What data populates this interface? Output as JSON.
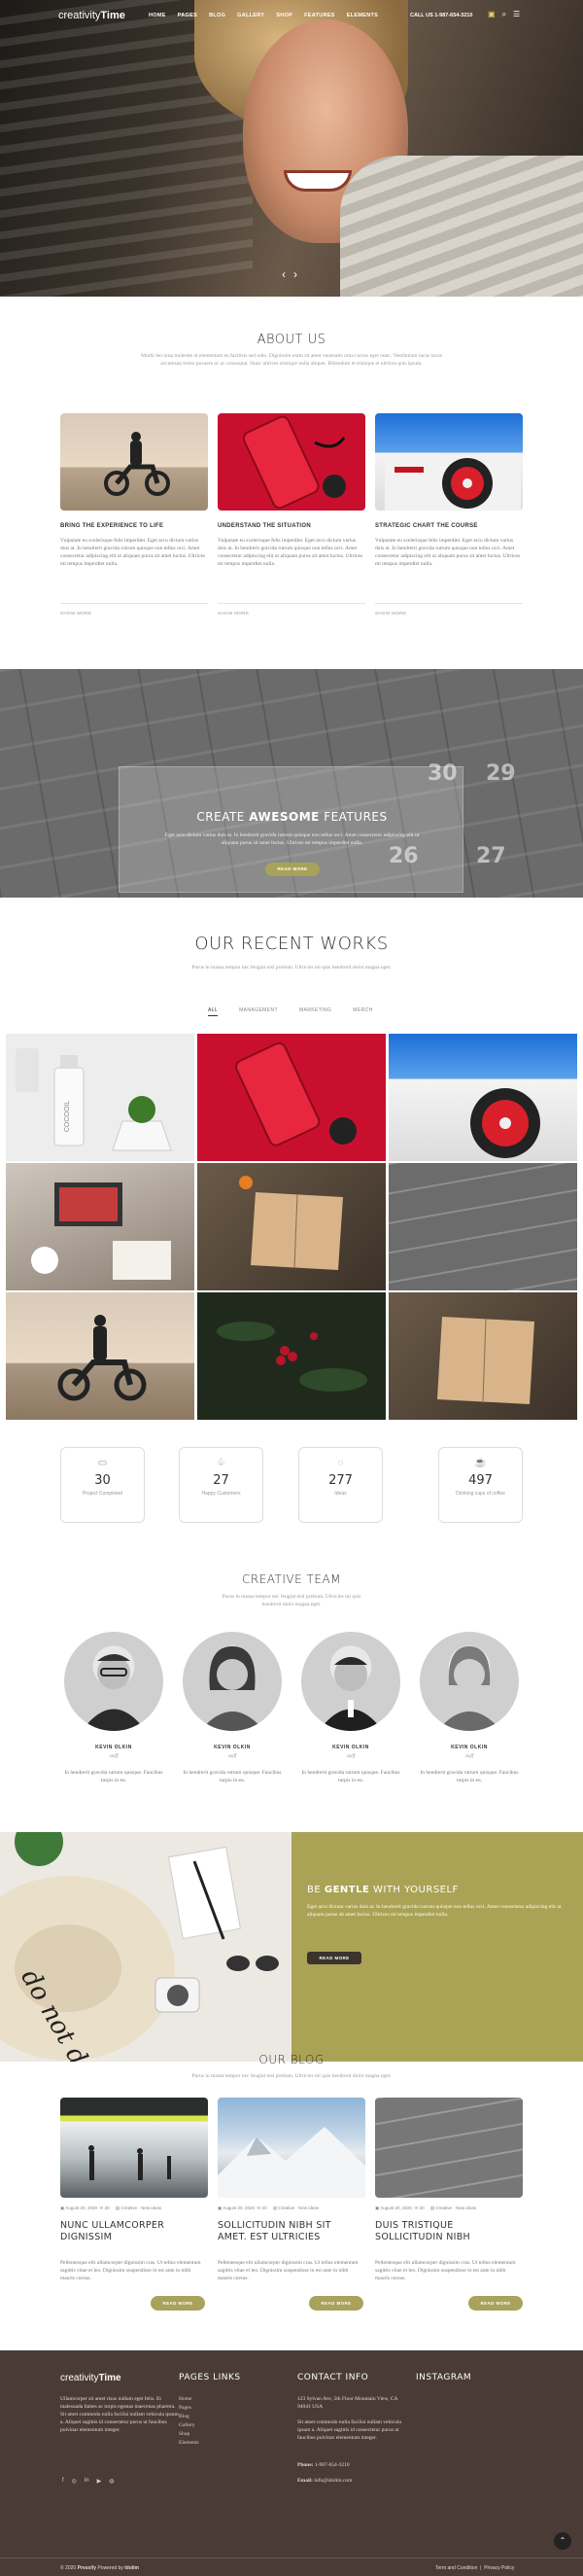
{
  "nav": {
    "logo_light": "creativity",
    "logo_bold": "Time",
    "items": [
      "HOME",
      "PAGES",
      "BLOG",
      "GALLERY",
      "SHOP",
      "FEATURES",
      "ELEMENTS"
    ],
    "call": "CALL US 1-987-654-3210"
  },
  "about": {
    "title": "ABOUT US",
    "subtitle": "Morbi leo urna molestie at elementum eu facilisis sed odio. Dignissim enim sit amet venenatis urna cursus eget nunc. Vestibulum lacus lacus accumsan tortor posuere ac ut consequat. Nunc ultrices tristique nulla aliquet. Bibendum et tristique et ultrices quis ipsum.",
    "cards": [
      {
        "title": "BRING THE EXPERIENCE TO LIFE",
        "text": "Vulputate eu scelerisque felis imperdiet. Eget arcu dictum varius duis at. In hendrerit gravida rutrum quisque non tellus orci. Amet consectetur adipiscing elit ut aliquam purus sit amet luctus. Ultrices mi tempus imperdiet nulla.",
        "more": "SHOW MORE"
      },
      {
        "title": "UNDERSTAND THE SITUATION",
        "text": "Vulputate eu scelerisque felis imperdiet. Eget arcu dictum varius duis at. In hendrerit gravida rutrum quisque non tellus orci. Amet consectetur adipiscing elit ut aliquam purus sit amet luctus. Ultrices mi tempus imperdiet nulla.",
        "more": "SHOW MORE"
      },
      {
        "title": "STRATEGIC CHART THE COURSE",
        "text": "Vulputate eu scelerisque felis imperdiet. Eget arcu dictum varius duis at. In hendrerit gravida rutrum quisque non tellus orci. Amet consectetur adipiscing elit ut aliquam purus sit amet luctus. Ultrices mi tempus imperdiet nulla.",
        "more": "SHOW MORE"
      }
    ]
  },
  "features": {
    "title_pre": "CREATE ",
    "title_bold": "AWESOME",
    "title_post": " FEATURES",
    "text": "Eget arcu dictum varius duis at. In hendrerit gravida rutrum quisque non tellus orci. Amet consectetur adipiscing elit ut aliquam purus sit amet luctus. Ultrices mi tempus imperdiet nulla.",
    "button": "READ MORE",
    "tile_numbers": [
      "30",
      "29",
      "27",
      "26"
    ]
  },
  "works": {
    "title": "OUR RECENT WORKS",
    "subtitle": "Purus in massa tempor nec feugiat nisl pretium. Ultricies mi quis hendrerit dolor magna eget.",
    "filters": [
      "ALL",
      "MANAGEMENT",
      "MARKETING",
      "MERCH"
    ],
    "bottle_label": "COCOOIL"
  },
  "stats": [
    {
      "num": "30",
      "label": "Project Completed",
      "icon": "monitor-icon"
    },
    {
      "num": "27",
      "label": "Happy Customers",
      "icon": "thumbs-up-icon"
    },
    {
      "num": "277",
      "label": "Ideas",
      "icon": "lightbulb-icon"
    },
    {
      "num": "497",
      "label": "Drinking cups of coffee",
      "icon": "coffee-icon"
    }
  ],
  "team": {
    "title": "CREATIVE TEAM",
    "subtitle": "Purus in massa tempor nec feugiat nisl pretium. Ultricies mi quis hendrerit dolor magna eget.",
    "members": [
      {
        "name": "KEVIN OLKIN",
        "role": "staff",
        "desc": "In hendrerit gravida rutrum quisque. Faucibus turpis in eu."
      },
      {
        "name": "KEVIN OLKIN",
        "role": "staff",
        "desc": "In hendrerit gravida rutrum quisque. Faucibus turpis in eu."
      },
      {
        "name": "KEVIN OLKIN",
        "role": "staff",
        "desc": "In hendrerit gravida rutrum quisque. Faucibus turpis in eu."
      },
      {
        "name": "KEVIN OLKIN",
        "role": "staff",
        "desc": "In hendrerit gravida rutrum quisque. Faucibus turpis in eu."
      }
    ]
  },
  "gentle": {
    "title_pre": "BE ",
    "title_bold": "GENTLE",
    "title_post": " WITH YOURSELF",
    "text": "Eget arcu dictum varius duis at. In hendrerit gravida rutrum quisque non tellus orci. Amet consectetur adipiscing elit ut aliquam purus sit amet luctus. Ultrices mi tempus imperdiet nulla.",
    "button": "READ MORE",
    "hat_text": "do not disturb"
  },
  "blog": {
    "title": "OUR BLOG",
    "subtitle": "Purus in massa tempor nec feugiat nisl pretium. Ultricies mi quis hendrerit dolor magna eget.",
    "posts": [
      {
        "date": "August 20, 2020",
        "comments": "20",
        "cats": "Creative · New ideas",
        "title": "NUNC ULLAMCORPER DIGNISSIM",
        "desc": "Pellentesque elit ullamcorper dignissim cras. Ut tellus elementum sagittis vitae et leo. Dignissim suspendisse in est ante in nibh mauris cursus.",
        "button": "READ MORE"
      },
      {
        "date": "August 20, 2020",
        "comments": "20",
        "cats": "Creative · New ideas",
        "title": "SOLLICITUDIN NIBH SIT AMET. EST ULTRICIES",
        "desc": "Pellentesque elit ullamcorper dignissim cras. Ut tellus elementum sagittis vitae et leo. Dignissim suspendisse in est ante in nibh mauris cursus.",
        "button": "READ MORE"
      },
      {
        "date": "August 20, 2020",
        "comments": "20",
        "cats": "Creative · New ideas",
        "title": "DUIS TRISTIQUE SOLLICITUDIN NIBH",
        "desc": "Pellentesque elit ullamcorper dignissim cras. Ut tellus elementum sagittis vitae et leo. Dignissim suspendisse in est ante in nibh mauris cursus.",
        "button": "READ MORE"
      }
    ]
  },
  "footer": {
    "logo_light": "creativity",
    "logo_bold": "Time",
    "about": "Ullamcorper sit amet risus nullam eget felis. Et malesuada fames ac turpis egestas maecenas pharetra. Sit amet commodo nulla facilisi nullam vehicula ipsum a. Aliquet sagittis id consectetur purus ut faucibus pulvinar elementum integer.",
    "links_title": "PAGES LINKS",
    "links": [
      "Home",
      "Pages",
      "Blog",
      "Gallery",
      "Shop",
      "Elements"
    ],
    "contact_title": "CONTACT INFO",
    "contact_address": "123 Sylvan Ave, 5th Floor Mountain View, CA 94041 USA",
    "contact_text": "Sit amet commodo nulla facilisi nullam vehicula ipsum a. Aliquet sagittis id consectetur purus ut faucibus pulvinar elementum integer.",
    "phone_label": "Phone:",
    "phone": "1-987-654-3210",
    "email_label": "Email:",
    "email": "info@idolim.com",
    "instagram_title": "INSTAGRAM",
    "copyright_pre": "© 2020 ",
    "copyright_brand": "Pressify",
    "copyright_mid": " Powered by ",
    "copyright_by": "Idolim",
    "terms": "Term and Condition",
    "policy": "Privacy Policy"
  }
}
